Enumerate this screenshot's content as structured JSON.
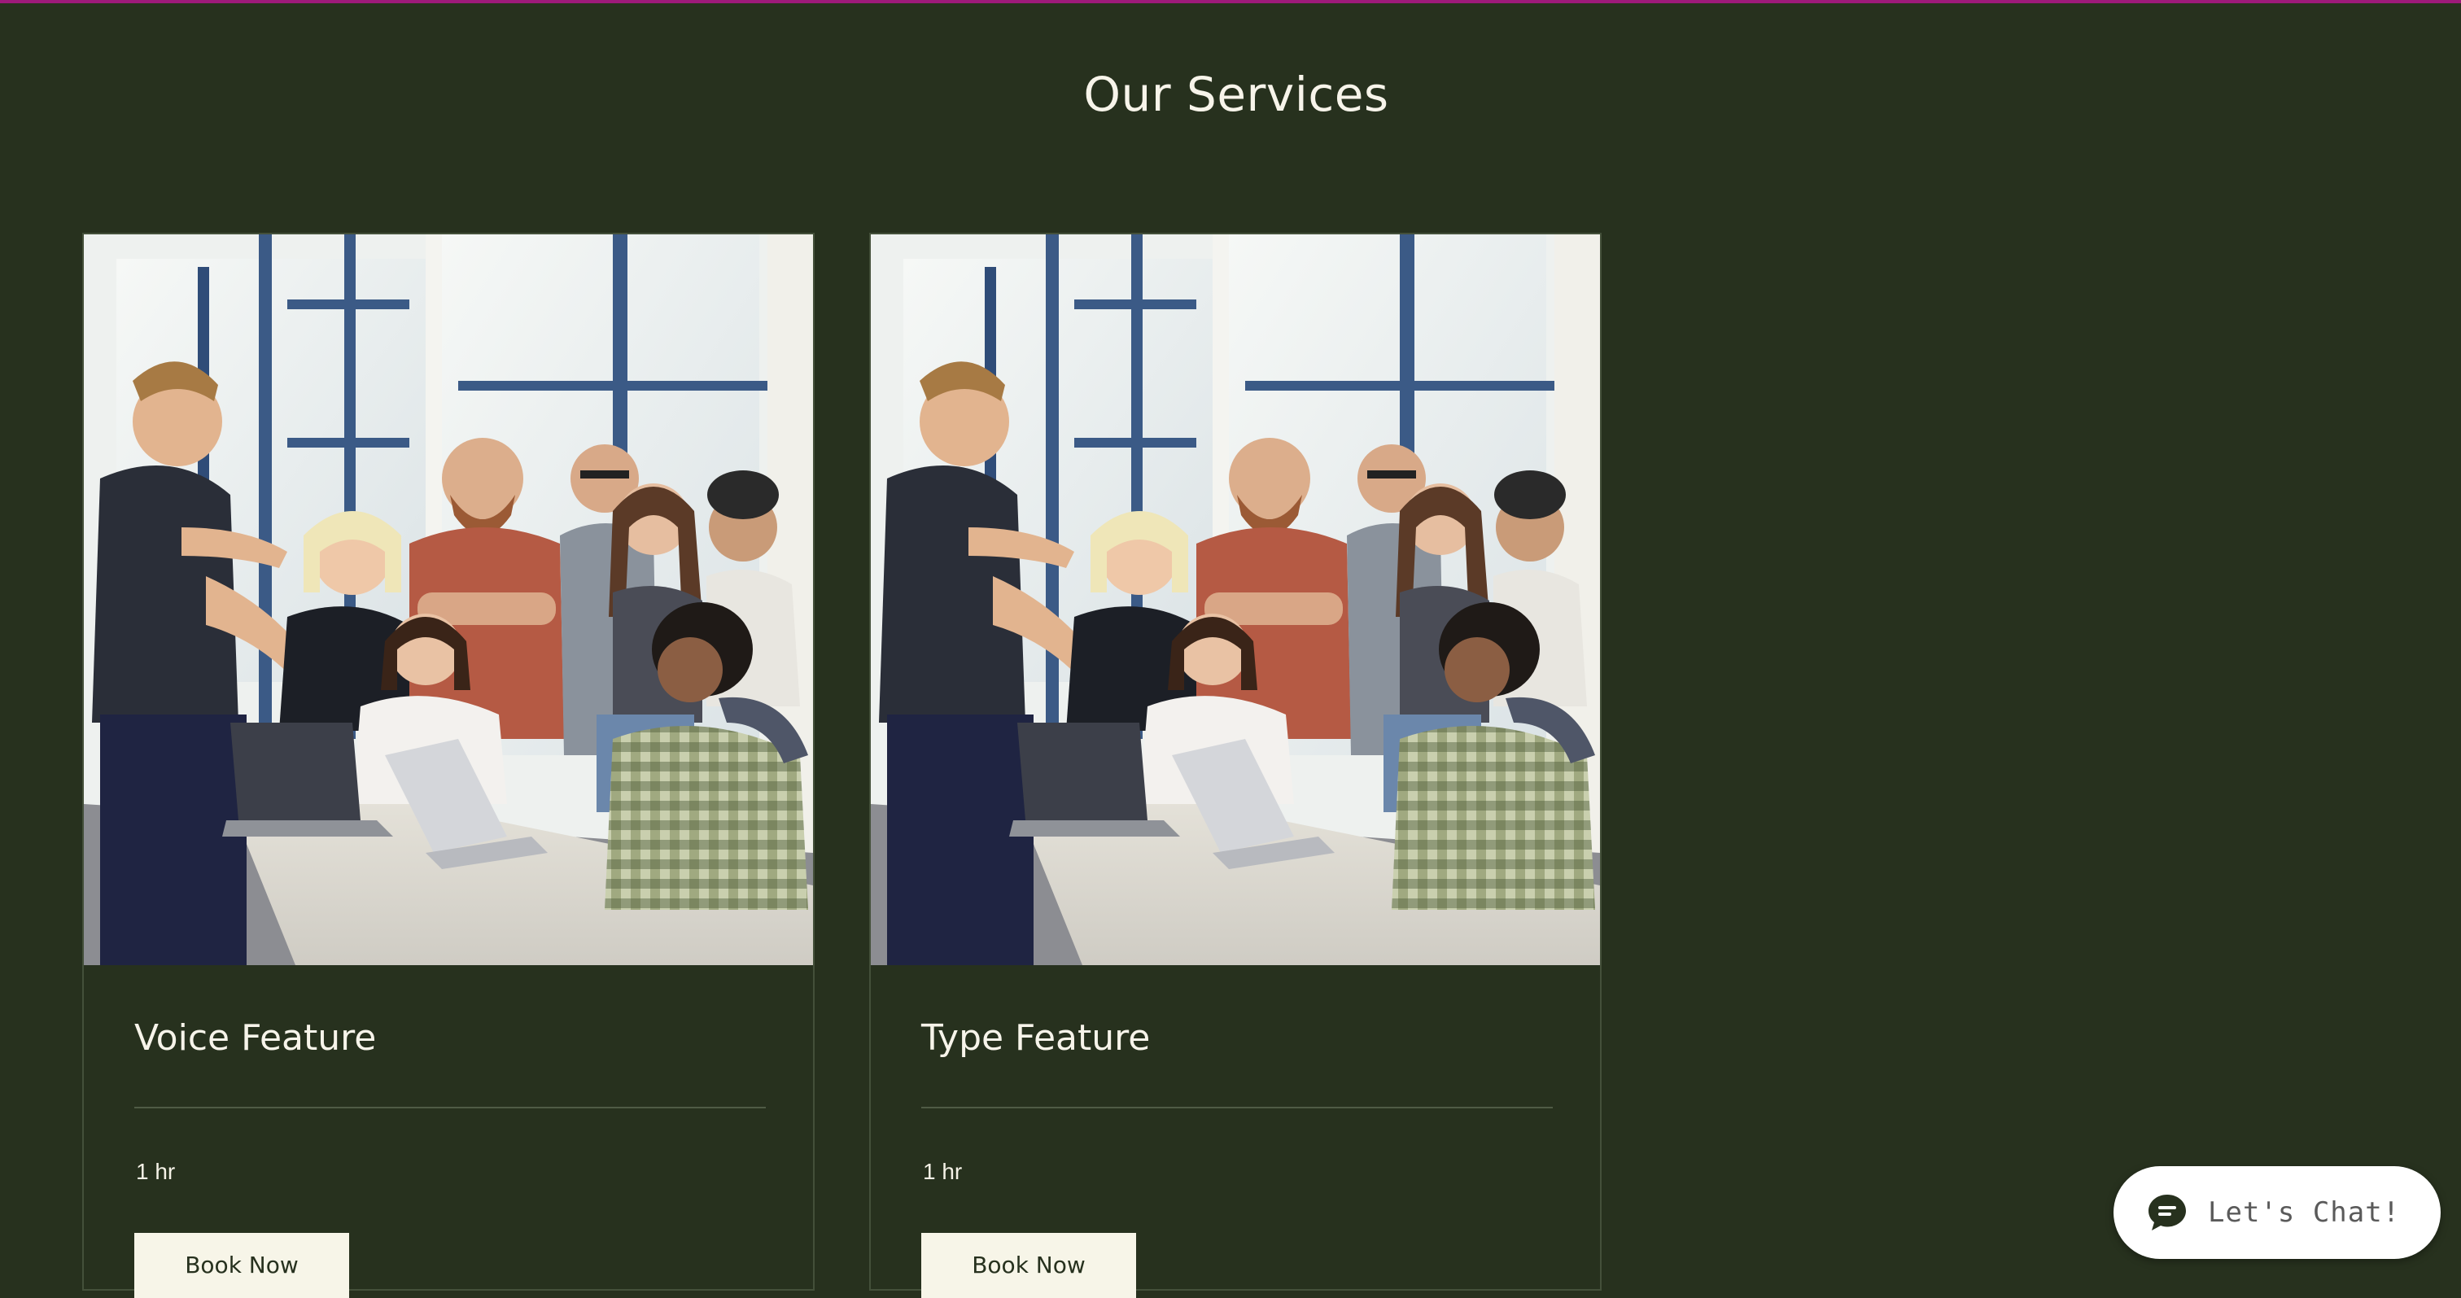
{
  "page": {
    "title": "Our Services",
    "accent_color": "#9e1a7a",
    "background_color": "#27311e"
  },
  "services": [
    {
      "name": "Voice Feature",
      "duration": "1 hr",
      "button_label": "Book Now",
      "image": "team-meeting-photo"
    },
    {
      "name": "Type Feature",
      "duration": "1 hr",
      "button_label": "Book Now",
      "image": "team-meeting-photo"
    }
  ],
  "chat": {
    "label": "Let's Chat!",
    "icon": "chat-bubble-icon"
  }
}
